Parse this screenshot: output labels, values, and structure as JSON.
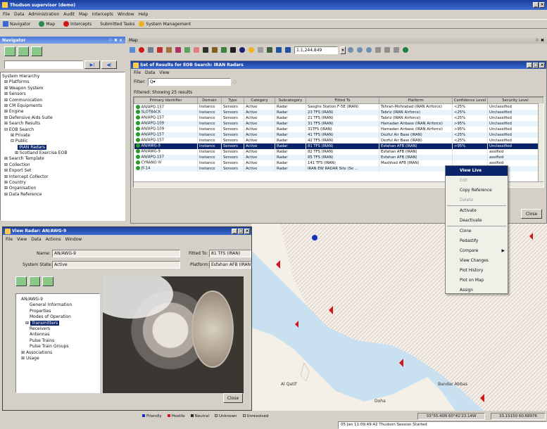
{
  "app": {
    "title": "Thudson supervisor (demo)"
  },
  "menu": [
    "File",
    "Data",
    "Administration",
    "Audit",
    "Map",
    "Intercepts",
    "Window",
    "Help"
  ],
  "toolbar": {
    "navigator": "Navigator",
    "map": "Map",
    "intercepts": "Intercepts",
    "submitted": "Submitted Tasks",
    "sysmgmt": "System Management"
  },
  "navigator": {
    "title": "Navigator",
    "controls": "⚐ ✖ ×",
    "tree_root": "System Hierarchy",
    "tree": [
      "⊞ Platforms",
      "⊞ Weapon System",
      "⊞ Sensors",
      "⊞ Communication",
      "⊞ CM Equipments",
      "⊞ Engine",
      "⊞ Defensive Aids Suite",
      "⊞ Search Results",
      "⊟ EOB Search",
      "⊞ Private",
      "⊟ Public",
      "IRAN Radars",
      "⊞ Scotland Exercise EOB",
      "⊞ Search Template",
      "⊞ Collection",
      "⊞ Export Set",
      "⊞ Intercept Collector",
      "⊞ Country",
      "⊞ Organisation",
      "⊞ Data Reference"
    ]
  },
  "map": {
    "title": "Map",
    "scale": "1:1,244,849",
    "controls": "⚐ ✖",
    "labels": [
      "Al Qatif",
      "Doha",
      "Bandar Abbas"
    ]
  },
  "results": {
    "title": "Set of Results for EOB Search: IRAN Radars",
    "menu": [
      "File",
      "Data",
      "View"
    ],
    "filter_label": "Filter:",
    "filtered": "Filtered: Showing 25 results",
    "columns": [
      "Primary Identifier",
      "Domain",
      "Type",
      "Category",
      "Subcategory",
      "Fitted To",
      "Platform",
      "Confidence Level",
      "Security Level"
    ],
    "rows": [
      [
        "AN/APQ-157",
        "Instance",
        "Sensors",
        "Active",
        "Radar",
        "Saeghe Station F-5E (IRAN)",
        "Tehran-Mehrabad (IRAN Airforce)",
        "<25%",
        "Unclassified"
      ],
      [
        "SLOTBACK",
        "Instance",
        "Sensors",
        "Active",
        "Radar",
        "23 TFS (IRAN)",
        "Tabriz (IRAN Airforce)",
        "<25%",
        "Unclassified"
      ],
      [
        "AN/APQ-157",
        "Instance",
        "Sensors",
        "Active",
        "Radar",
        "21 TFS (IRAN)",
        "Tabriz (IRAN Airforce)",
        "<25%",
        "Unclassified"
      ],
      [
        "AN/APQ-109",
        "Instance",
        "Sensors",
        "Active",
        "Radar",
        "31 TFS (IRAN)",
        "Hamadan Airbase (IRAN Airforce)",
        ">95%",
        "Unclassified"
      ],
      [
        "AN/APQ-109",
        "Instance",
        "Sensors",
        "Active",
        "Radar",
        "31TFS (IRAN)",
        "Hamadan Airbase (IRAN Airforce)",
        ">95%",
        "Unclassified"
      ],
      [
        "AN/APQ-157",
        "Instance",
        "Sensors",
        "Active",
        "Radar",
        "41 TFS (IRAN)",
        "Dezful Air Base (IRAN)",
        "<25%",
        "Unclassified"
      ],
      [
        "AN/APQ-157",
        "Instance",
        "Sensors",
        "Active",
        "Radar",
        "42 TFS (IRAN)",
        "Dezful Air Base (IRAN)",
        "<25%",
        "Unclassified"
      ],
      [
        "AN/AWG-9",
        "Instance",
        "Sensors",
        "Active",
        "Radar",
        "81 TFS (IRAN)",
        "Esfahan AFB (IRAN)",
        ">95%",
        "Unclassified"
      ],
      [
        "AN/AWG-9",
        "Instance",
        "Sensors",
        "Active",
        "Radar",
        "82 TFS (IRAN)",
        "Esfahan AFB (IRAN)",
        "",
        "assified"
      ],
      [
        "AN/APQ-157",
        "Instance",
        "Sensors",
        "Active",
        "Radar",
        "85 TFS (IRAN)",
        "Esfahan AFB (IRAN)",
        "",
        "assified"
      ],
      [
        "CYRANO IV",
        "Instance",
        "Sensors",
        "Active",
        "Radar",
        "141 TFS (IRAN)",
        "Mashhad AFB (IRAN)",
        "",
        "assified"
      ],
      [
        "JY-14",
        "Instance",
        "Sensors",
        "Active",
        "Radar",
        "IRAN EW RADAR Site (Se ...",
        "",
        "",
        "assified"
      ]
    ],
    "close": "Close"
  },
  "context_menu": [
    "View Live",
    "Edit",
    "Copy Reference",
    "Delete",
    "Activate",
    "Deactivate",
    "Clone",
    "Pedastify",
    "Compare",
    "View Changes",
    "Plot History",
    "Plot on Map",
    "Assign"
  ],
  "detail": {
    "title": "View Radar: AN/AWG-9",
    "menu": [
      "File",
      "View",
      "Data",
      "Actions",
      "Window"
    ],
    "name_label": "Name:",
    "name_value": "AN/AWG-9",
    "state_label": "System State:",
    "state_value": "Active",
    "fitted_label": "Fitted To:",
    "fitted_value": "81 TFS (IRAN)",
    "platform_label": "Platform:",
    "platform_value": "Esfahan AFB (IRAN",
    "tree": [
      "AN/AWG-9",
      "General Information",
      "Properties",
      "Modes of Operation",
      "Transmitters",
      "Receivers",
      "Antennas",
      "Pulse Trains",
      "Pulse Train Groups",
      "Associations",
      "Usage"
    ],
    "close": "Close"
  },
  "legend": [
    "Friendly",
    "Hostile",
    "Neutral",
    "Unknown",
    "Unresolved"
  ],
  "status": {
    "coords1": "33°55.40N 60°41'23.14W",
    "coords2": "33.15150 60.68976",
    "msg": "05 Jan 11:09:49:42 Thudson Session Started"
  },
  "colors": {
    "title_bg": "#1c3f9c",
    "selection": "#0a246a",
    "hostile": "#d01818",
    "friendly": "#1030c0",
    "sea": "#c8e0f0",
    "land": "#f4f0e8"
  }
}
